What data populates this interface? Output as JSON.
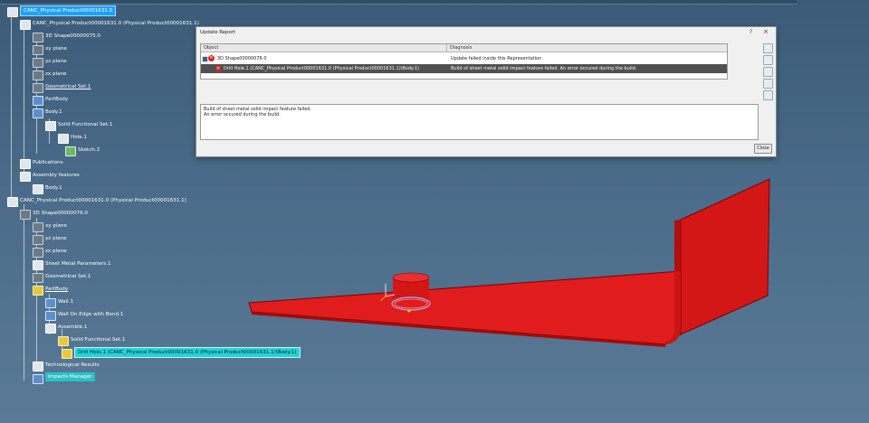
{
  "tree": {
    "product_root": "CANC_Physical Product00001631.0",
    "nodes": [
      "CANC_Physical Product00001631.0 (Physical Product00001631.1)",
      "3D Shape00000075.0",
      "xy plane",
      "yz plane",
      "zx plane",
      "Geometrical Set.1",
      "PartBody",
      "Body.1",
      "Solid Functional Set.1",
      "Hole.1",
      "Sketch.2",
      "Publications",
      "Assembly features",
      "Body.1",
      "CANC_Physical Product00001631.0 (Physical Product00001631.1)",
      "3D Shape00000076.0",
      "xy plane",
      "yz plane",
      "zx plane",
      "Sheet Metal Parameters.1",
      "Geometrical Set.1",
      "PartBody",
      "Wall.1",
      "Wall On Edge with Bend.1",
      "Assemble.1",
      "Solid Functional Set.1",
      "Drill Hole.1 (CANC_Physical Product00001631.0 (Physical Product00001631.1)\\Body.1)",
      "Technological Results",
      "Impacts Manager"
    ]
  },
  "dialog": {
    "title": "Update Report",
    "help": "?",
    "close_x": "×",
    "columns": [
      "Object",
      "Diagnosis"
    ],
    "rows": [
      {
        "object": "3D Shape00000076.0",
        "diagnosis": "Update failed inside this Representation"
      },
      {
        "object": "Drill Hole.1 (CANC_Physical Product00001631.0 (Physical Product00001631.1)\\Body.1)",
        "diagnosis": "Build of sheet metal solid impact feature failed. An error occured during the build."
      }
    ],
    "message_line1": "Build of sheet metal solid impact feature failed.",
    "message_line2": "An error occured during the build.",
    "close_button": "Close"
  },
  "colors": {
    "background": "#4a6b89",
    "part": "#d21616",
    "selection": "#1ea0ff",
    "error_highlight": "#24d3d8"
  }
}
